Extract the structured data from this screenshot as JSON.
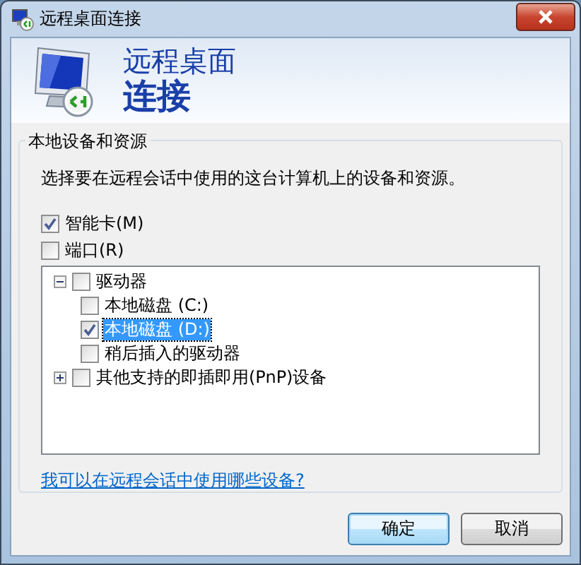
{
  "window": {
    "title": "远程桌面连接"
  },
  "header": {
    "line1": "远程桌面",
    "line2": "连接"
  },
  "group": {
    "title": "本地设备和资源",
    "description": "选择要在远程会话中使用的这台计算机上的设备和资源。"
  },
  "options": [
    {
      "label": "智能卡(M)",
      "checked": true
    },
    {
      "label": "端口(R)",
      "checked": false
    }
  ],
  "tree": [
    {
      "label": "驱动器",
      "checked": false,
      "expanded": true,
      "selected": false,
      "children": [
        {
          "label": "本地磁盘 (C:)",
          "checked": false,
          "selected": false
        },
        {
          "label": "本地磁盘 (D:)",
          "checked": true,
          "selected": true
        },
        {
          "label": "稍后插入的驱动器",
          "checked": false,
          "selected": false
        }
      ]
    },
    {
      "label": "其他支持的即插即用(PnP)设备",
      "checked": false,
      "expanded": false,
      "selected": false
    }
  ],
  "help_link": "我可以在远程会话中使用哪些设备?",
  "buttons": [
    {
      "label": "确定",
      "default": true
    },
    {
      "label": "取消",
      "default": false
    }
  ]
}
